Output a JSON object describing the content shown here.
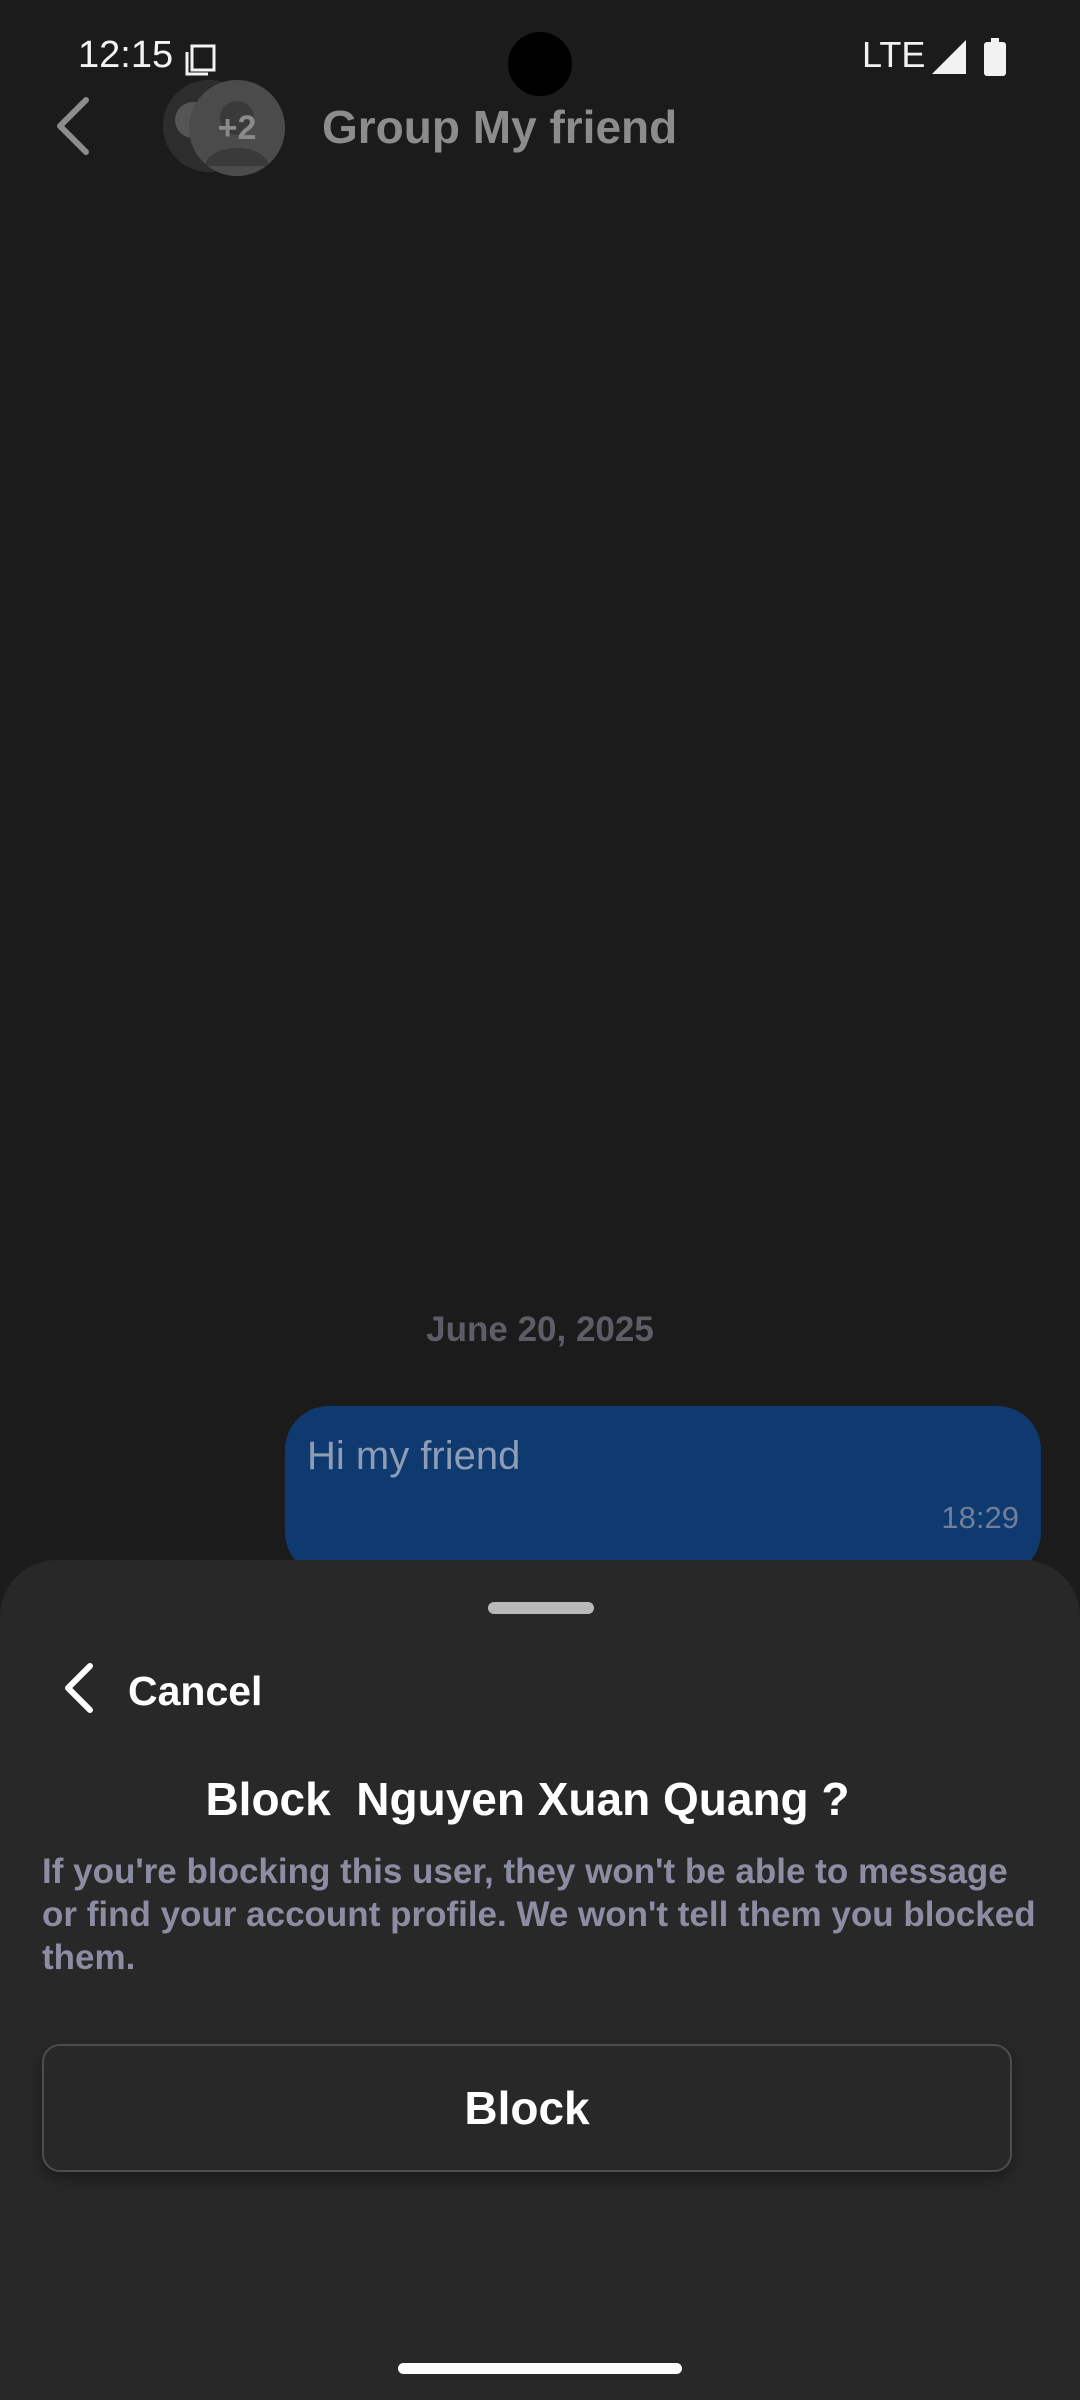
{
  "status_bar": {
    "time": "12:15",
    "network": "LTE",
    "icons": [
      "screen-record-icon",
      "signal-icon",
      "battery-icon"
    ]
  },
  "header": {
    "title": "Group My friend",
    "avatar_extra_count": "+2",
    "back_icon": "chevron-left-icon"
  },
  "messages": {
    "date_separator": "June 20, 2025",
    "items": [
      {
        "text": "Hi my friend",
        "time": "18:29",
        "outgoing": true
      }
    ]
  },
  "block_sheet": {
    "cancel_label": "Cancel",
    "title": "Block  Nguyen Xuan Quang ?",
    "description": "If you're blocking this user, they won't be able to message or find your account profile. We won't tell them you blocked them.",
    "block_button_label": "Block"
  },
  "colors": {
    "background": "#1b1b1b",
    "sheet": "#282828",
    "bubble": "#0f3a70",
    "description_text": "#8c8ca3",
    "header_title": "#8c8c8c"
  }
}
